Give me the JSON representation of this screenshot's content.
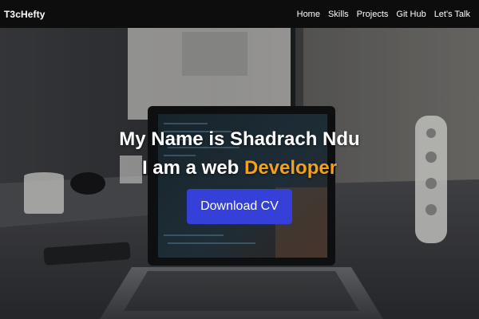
{
  "navbar": {
    "brand": "T3cHefty",
    "links": [
      {
        "label": "Home"
      },
      {
        "label": "Skills"
      },
      {
        "label": "Projects"
      },
      {
        "label": "Git Hub"
      },
      {
        "label": "Let's Talk"
      }
    ]
  },
  "hero": {
    "name_line": "My Name is Shadrach Ndu",
    "role_prefix": "I am a web ",
    "role_highlight": "Developer",
    "cta_label": "Download CV"
  },
  "colors": {
    "navbar_bg": "#0d0d0e",
    "accent": "#f5a016",
    "button": "#3440d8"
  }
}
